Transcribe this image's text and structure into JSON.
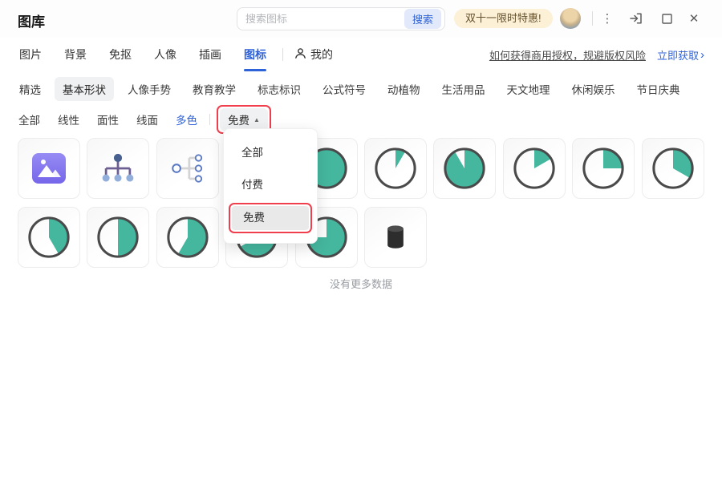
{
  "colors": {
    "accent_blue": "#2e62d9",
    "pie_teal": "#45b79f",
    "pie_ring": "#4a4a4a",
    "image_icon_purple": "#8278ef",
    "annotation_red": "#f03e4d",
    "promo_bg": "#fcf0d6",
    "selected_pill_bg": "#f0f1f3",
    "cylinder_dark": "#2d2d2d"
  },
  "titlebar": {
    "app_title": "图库",
    "search_placeholder": "搜索图标",
    "search_button": "搜索",
    "promo_badge": "双十一限时特惠!",
    "window_icons": [
      "avatar",
      "kebab-menu-icon",
      "sign-in-icon",
      "maximize-icon",
      "close-icon"
    ]
  },
  "nav": {
    "tabs": [
      {
        "label": "图片",
        "active": false
      },
      {
        "label": "背景",
        "active": false
      },
      {
        "label": "免抠",
        "active": false
      },
      {
        "label": "人像",
        "active": false
      },
      {
        "label": "插画",
        "active": false
      },
      {
        "label": "图标",
        "active": true
      }
    ],
    "my_tab": "我的",
    "license_link": "如何获得商用授权，规避版权风险",
    "get_now_link": "立即获取",
    "get_now_chevron": "›"
  },
  "categories": [
    {
      "label": "精选",
      "selected": false
    },
    {
      "label": "基本形状",
      "selected": true
    },
    {
      "label": "人像手势",
      "selected": false
    },
    {
      "label": "教育教学",
      "selected": false
    },
    {
      "label": "标志标识",
      "selected": false
    },
    {
      "label": "公式符号",
      "selected": false
    },
    {
      "label": "动植物",
      "selected": false
    },
    {
      "label": "生活用品",
      "selected": false
    },
    {
      "label": "天文地理",
      "selected": false
    },
    {
      "label": "休闲娱乐",
      "selected": false
    },
    {
      "label": "节日庆典",
      "selected": false
    }
  ],
  "filters": {
    "styles": [
      {
        "label": "全部",
        "selected": false
      },
      {
        "label": "线性",
        "selected": false
      },
      {
        "label": "面性",
        "selected": false
      },
      {
        "label": "线面",
        "selected": false
      },
      {
        "label": "多色",
        "selected": true
      }
    ],
    "price_button_label": "免费",
    "price_button_caret": "▲",
    "dropdown": {
      "items": [
        {
          "label": "全部",
          "selected": false
        },
        {
          "label": "付费",
          "selected": false
        },
        {
          "label": "免费",
          "selected": true
        }
      ]
    }
  },
  "grid": {
    "items": [
      {
        "icon": "image-picture"
      },
      {
        "icon": "org-chart"
      },
      {
        "icon": "mind-map"
      },
      {
        "icon": "covered-by-dropdown"
      },
      {
        "icon": "pie-chart",
        "angle": 360
      },
      {
        "icon": "pie-chart",
        "angle": 30
      },
      {
        "icon": "pie-chart",
        "angle": 330
      },
      {
        "icon": "pie-chart",
        "angle": 60
      },
      {
        "icon": "pie-chart",
        "angle": 90
      },
      {
        "icon": "pie-chart",
        "angle": 120
      },
      {
        "icon": "pie-chart",
        "angle": 150
      },
      {
        "icon": "pie-chart",
        "angle": 180
      },
      {
        "icon": "pie-chart",
        "angle": 210
      },
      {
        "icon": "pie-chart",
        "angle": 240
      },
      {
        "icon": "pie-chart",
        "angle": 270
      },
      {
        "icon": "cylinder-database"
      }
    ],
    "no_more_text": "没有更多数据"
  }
}
